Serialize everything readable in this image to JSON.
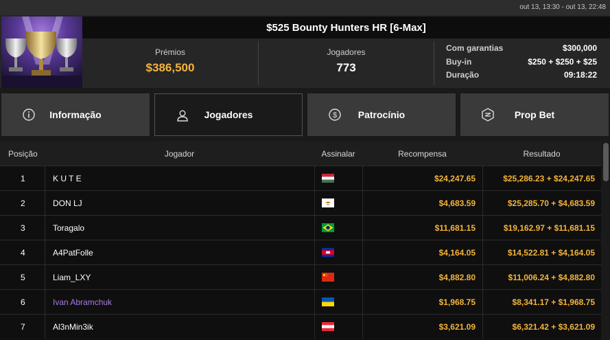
{
  "date_range": "out 13, 13:30 - out 13, 22:48",
  "tournament": {
    "title": "$525 Bounty Hunters HR [6-Max]",
    "prize_label": "Prémios",
    "prize_value": "$386,500",
    "players_label": "Jogadores",
    "players_value": "773",
    "guarantee_label": "Com garantias",
    "guarantee_value": "$300,000",
    "buyin_label": "Buy-in",
    "buyin_value": "$250 + $250 + $25",
    "duration_label": "Duração",
    "duration_value": "09:18:22"
  },
  "tabs": [
    {
      "label": "Informação",
      "icon": "info-icon"
    },
    {
      "label": "Jogadores",
      "icon": "user-icon"
    },
    {
      "label": "Patrocínio",
      "icon": "dollar-coin-icon"
    },
    {
      "label": "Prop Bet",
      "icon": "prop-bet-icon"
    }
  ],
  "active_tab": "Jogadores",
  "table": {
    "headers": {
      "position": "Posição",
      "player": "Jogador",
      "flag": "Assinalar",
      "reward": "Recompensa",
      "result": "Resultado"
    },
    "rows": [
      {
        "position": "1",
        "player": "K U T E",
        "flag": "hungary",
        "reward": "$24,247.65",
        "result": "$25,286.23 + $24,247.65"
      },
      {
        "position": "2",
        "player": "DON LJ",
        "flag": "cyprus",
        "reward": "$4,683.59",
        "result": "$25,285.70 + $4,683.59"
      },
      {
        "position": "3",
        "player": "Toragalo",
        "flag": "brazil",
        "reward": "$11,681.15",
        "result": "$19,162.97 + $11,681.15"
      },
      {
        "position": "4",
        "player": "A4PatFolle",
        "flag": "cambodia",
        "reward": "$4,164.05",
        "result": "$14,522.81 + $4,164.05"
      },
      {
        "position": "5",
        "player": "Liam_LXY",
        "flag": "china",
        "reward": "$4,882.80",
        "result": "$11,006.24 + $4,882.80"
      },
      {
        "position": "6",
        "player": "Ivan Abramchuk",
        "flag": "ukraine",
        "reward": "$1,968.75",
        "result": "$8,341.17 + $1,968.75",
        "highlight": true
      },
      {
        "position": "7",
        "player": "Al3nMin3ik",
        "flag": "austria",
        "reward": "$3,621.09",
        "result": "$6,321.42 + $3,621.09"
      }
    ]
  },
  "colors": {
    "accent_gold": "#f4b43a",
    "highlight_purple": "#a57ce8",
    "active_tab_bg": "#1a1a1a",
    "tab_bg": "#3a3a3a"
  }
}
